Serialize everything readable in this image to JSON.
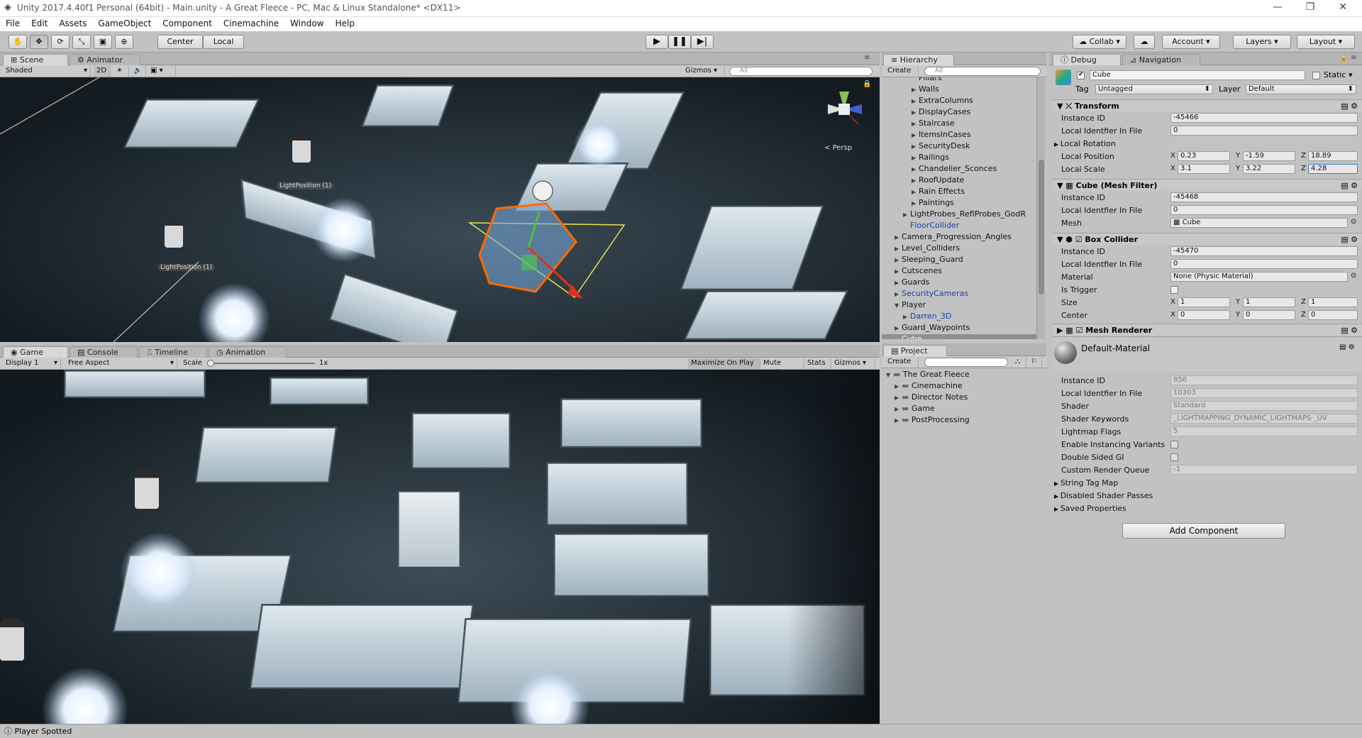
{
  "window": {
    "title": "Unity 2017.4.40f1 Personal (64bit) - Main.unity - A Great Fleece - PC, Mac & Linux Standalone* <DX11>"
  },
  "menu": [
    "File",
    "Edit",
    "Assets",
    "GameObject",
    "Component",
    "Cinemachine",
    "Window",
    "Help"
  ],
  "toolbar": {
    "pivot_center": "Center",
    "pivot_local": "Local",
    "collab": "Collab",
    "account": "Account",
    "layers": "Layers",
    "layout": "Layout"
  },
  "scene": {
    "tab": "Scene",
    "tab2": "Animator",
    "shading": "Shaded",
    "mode2d": "2D",
    "gizmos": "Gizmos",
    "search_placeholder": "All",
    "persp": "Persp",
    "light_label_1": "LightPosition (1)",
    "light_label_2": "LightPosition (1)"
  },
  "game": {
    "tabs": [
      "Game",
      "Console",
      "Timeline",
      "Animation"
    ],
    "display": "Display 1",
    "aspect": "Free Aspect",
    "scale_label": "Scale",
    "scale_value": "1x",
    "buttons": [
      "Maximize On Play",
      "Mute Audio",
      "Stats",
      "Gizmos"
    ]
  },
  "hierarchy": {
    "tab": "Hierarchy",
    "create": "Create",
    "search_placeholder": "All",
    "items": [
      {
        "label": "Pillars",
        "indent": 3,
        "arrow": "",
        "blue": false
      },
      {
        "label": "Walls",
        "indent": 3,
        "arrow": "▶",
        "blue": false
      },
      {
        "label": "ExtraColumns",
        "indent": 3,
        "arrow": "▶",
        "blue": false
      },
      {
        "label": "DisplayCases",
        "indent": 3,
        "arrow": "▶",
        "blue": false
      },
      {
        "label": "Staircase",
        "indent": 3,
        "arrow": "▶",
        "blue": false
      },
      {
        "label": "ItemsInCases",
        "indent": 3,
        "arrow": "▶",
        "blue": false
      },
      {
        "label": "SecurityDesk",
        "indent": 3,
        "arrow": "▶",
        "blue": false
      },
      {
        "label": "Railings",
        "indent": 3,
        "arrow": "▶",
        "blue": false
      },
      {
        "label": "Chandelier_Sconces",
        "indent": 3,
        "arrow": "▶",
        "blue": false
      },
      {
        "label": "RoofUpdate",
        "indent": 3,
        "arrow": "▶",
        "blue": false
      },
      {
        "label": "Rain Effects",
        "indent": 3,
        "arrow": "▶",
        "blue": false
      },
      {
        "label": "Paintings",
        "indent": 3,
        "arrow": "▶",
        "blue": false
      },
      {
        "label": "LightProbes_ReflProbes_GodR",
        "indent": 2,
        "arrow": "▶",
        "blue": false
      },
      {
        "label": "FloorCollider",
        "indent": 2,
        "arrow": "",
        "blue": true
      },
      {
        "label": "Camera_Progression_Angles",
        "indent": 1,
        "arrow": "▶",
        "blue": false
      },
      {
        "label": "Level_Colliders",
        "indent": 1,
        "arrow": "▶",
        "blue": false
      },
      {
        "label": "Sleeping_Guard",
        "indent": 1,
        "arrow": "▶",
        "blue": false
      },
      {
        "label": "Cutscenes",
        "indent": 1,
        "arrow": "▶",
        "blue": false
      },
      {
        "label": "Guards",
        "indent": 1,
        "arrow": "▶",
        "blue": false
      },
      {
        "label": "SecurityCameras",
        "indent": 1,
        "arrow": "▶",
        "blue": true
      },
      {
        "label": "Player",
        "indent": 1,
        "arrow": "▼",
        "blue": false
      },
      {
        "label": "Darren_3D",
        "indent": 2,
        "arrow": "▶",
        "blue": true
      },
      {
        "label": "Guard_Waypoints",
        "indent": 1,
        "arrow": "▶",
        "blue": false
      },
      {
        "label": "Cube",
        "indent": 1,
        "arrow": "",
        "blue": false,
        "selected": true
      }
    ]
  },
  "project": {
    "tab": "Project",
    "create": "Create",
    "items": [
      {
        "label": "The Great Fleece",
        "indent": 0,
        "arrow": "▼"
      },
      {
        "label": "Cinemachine",
        "indent": 1,
        "arrow": "▶"
      },
      {
        "label": "Director Notes",
        "indent": 1,
        "arrow": "▶"
      },
      {
        "label": "Game",
        "indent": 1,
        "arrow": "▶"
      },
      {
        "label": "PostProcessing",
        "indent": 1,
        "arrow": "▶"
      }
    ]
  },
  "inspector": {
    "tab": "Debug",
    "tab2": "Navigation",
    "object_name": "Cube",
    "static_label": "Static",
    "tag_label": "Tag",
    "tag_value": "Untagged",
    "layer_label": "Layer",
    "layer_value": "Default",
    "transform": {
      "title": "Transform",
      "instance_id_label": "Instance ID",
      "instance_id": "-45466",
      "local_id_label": "Local Identfier In File",
      "local_id": "0",
      "rotation_label": "Local Rotation",
      "position_label": "Local Position",
      "pos_x": "0.23",
      "pos_y": "-1.59",
      "pos_z": "18.89",
      "scale_label": "Local Scale",
      "scale_x": "3.1",
      "scale_y": "3.22",
      "scale_z": "4.28"
    },
    "mesh_filter": {
      "title": "Cube (Mesh Filter)",
      "instance_id_label": "Instance ID",
      "instance_id": "-45468",
      "local_id_label": "Local Identfier In File",
      "local_id": "0",
      "mesh_label": "Mesh",
      "mesh": "Cube"
    },
    "box_collider": {
      "title": "Box Collider",
      "instance_id_label": "Instance ID",
      "instance_id": "-45470",
      "local_id_label": "Local Identfier In File",
      "local_id": "0",
      "material_label": "Material",
      "material": "None (Physic Material)",
      "trigger_label": "Is Trigger",
      "size_label": "Size",
      "size_x": "1",
      "size_y": "1",
      "size_z": "1",
      "center_label": "Center",
      "center_x": "0",
      "center_y": "0",
      "center_z": "0"
    },
    "mesh_renderer": {
      "title": "Mesh Renderer"
    },
    "material": {
      "name": "Default-Material",
      "rows": [
        {
          "label": "Instance ID",
          "value": "856"
        },
        {
          "label": "Local Identfier In File",
          "value": "10303"
        },
        {
          "label": "Shader",
          "value": "Standard"
        },
        {
          "label": "Shader Keywords",
          "value": "_LIGHTMAPPING_DYNAMIC_LIGHTMAPS _UV"
        },
        {
          "label": "Lightmap Flags",
          "value": "5"
        },
        {
          "label": "Enable Instancing Variants",
          "value": ""
        },
        {
          "label": "Double Sided GI",
          "value": ""
        },
        {
          "label": "Custom Render Queue",
          "value": "-1"
        }
      ],
      "foldouts": [
        "String Tag Map",
        "Disabled Shader Passes",
        "Saved Properties"
      ]
    },
    "add_component": "Add Component"
  },
  "axes": {
    "x": "X",
    "y": "Y",
    "z": "Z"
  },
  "status": {
    "text": "Player Spotted"
  }
}
